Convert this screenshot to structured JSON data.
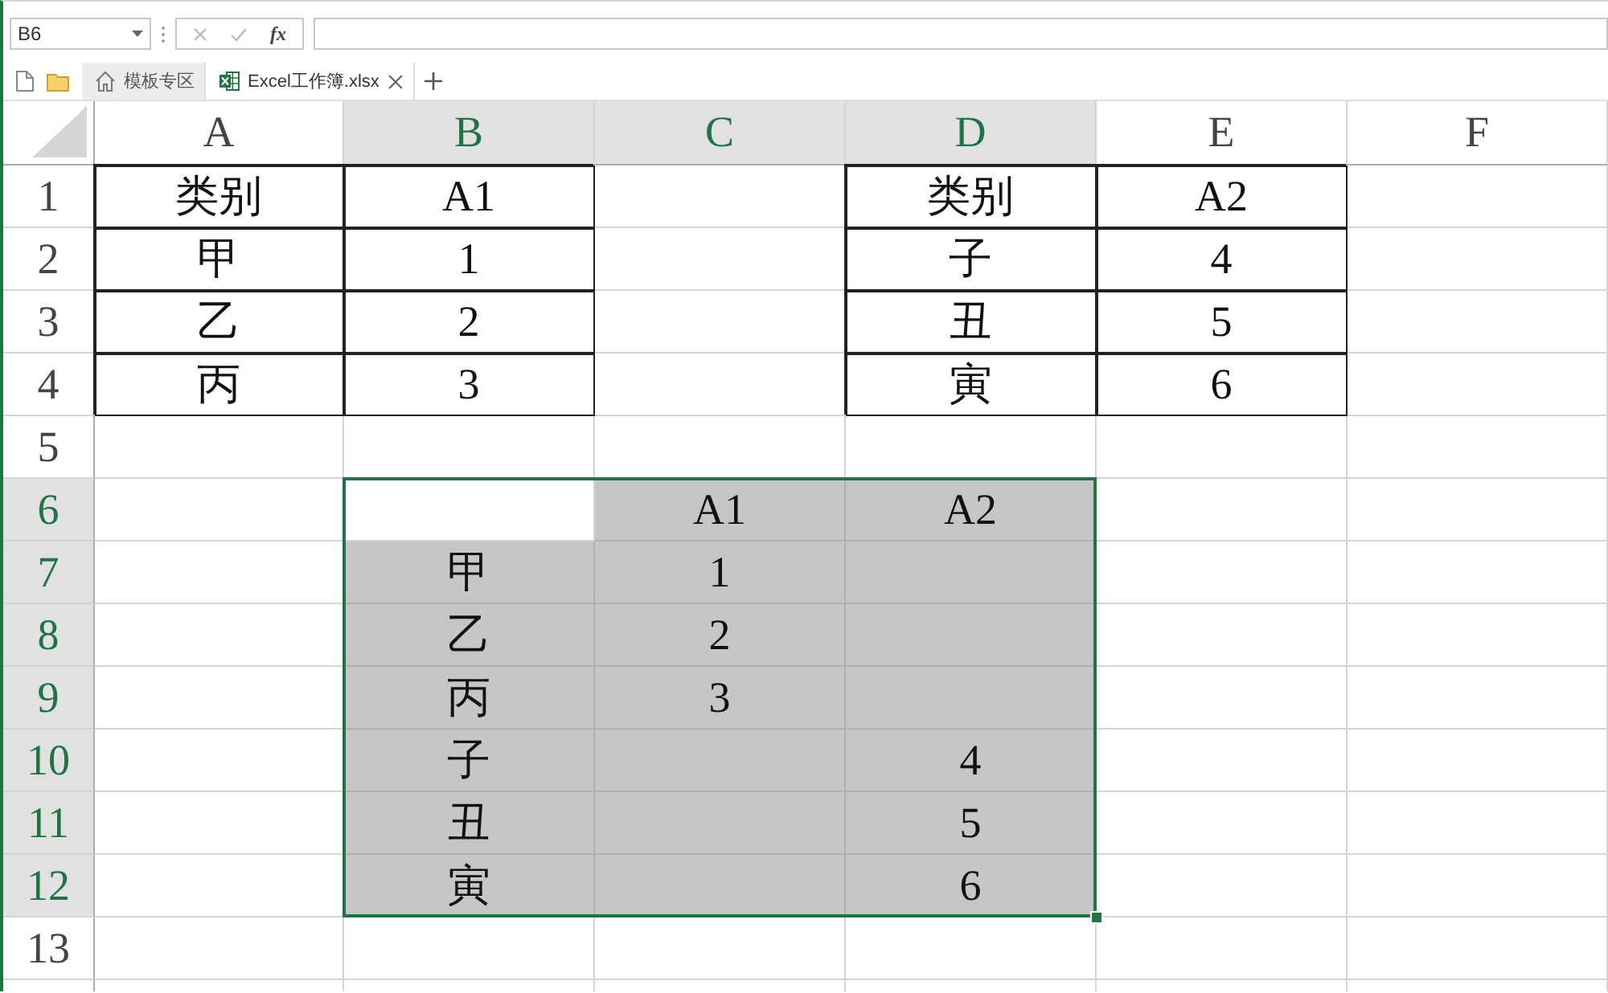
{
  "name_box": {
    "value": "B6"
  },
  "formula_bar": {
    "function_button": "fx"
  },
  "tabs": [
    {
      "label": "模板专区",
      "kind": "home",
      "selected": false,
      "closable": false
    },
    {
      "label": "Excel工作簿.xlsx",
      "kind": "workbook",
      "selected": true,
      "closable": true
    }
  ],
  "columns": [
    {
      "label": "A",
      "selected": false
    },
    {
      "label": "B",
      "selected": true
    },
    {
      "label": "C",
      "selected": true
    },
    {
      "label": "D",
      "selected": true
    },
    {
      "label": "E",
      "selected": false
    },
    {
      "label": "F",
      "selected": false
    }
  ],
  "rows": [
    {
      "label": "1",
      "selected": false,
      "cells": [
        {
          "text": "类别",
          "bordered": true,
          "shaded": false
        },
        {
          "text": "A1",
          "bordered": true,
          "shaded": false
        },
        {
          "bordered": false,
          "shaded": false
        },
        {
          "text": "类别",
          "bordered": true,
          "shaded": false
        },
        {
          "text": "A2",
          "bordered": true,
          "shaded": false
        },
        {
          "bordered": false,
          "shaded": false
        }
      ]
    },
    {
      "label": "2",
      "selected": false,
      "cells": [
        {
          "text": "甲",
          "bordered": true,
          "shaded": false
        },
        {
          "text": "1",
          "bordered": true,
          "shaded": false
        },
        {
          "bordered": false,
          "shaded": false
        },
        {
          "text": "子",
          "bordered": true,
          "shaded": false
        },
        {
          "text": "4",
          "bordered": true,
          "shaded": false
        },
        {
          "bordered": false,
          "shaded": false
        }
      ]
    },
    {
      "label": "3",
      "selected": false,
      "cells": [
        {
          "text": "乙",
          "bordered": true,
          "shaded": false
        },
        {
          "text": "2",
          "bordered": true,
          "shaded": false
        },
        {
          "bordered": false,
          "shaded": false
        },
        {
          "text": "丑",
          "bordered": true,
          "shaded": false
        },
        {
          "text": "5",
          "bordered": true,
          "shaded": false
        },
        {
          "bordered": false,
          "shaded": false
        }
      ]
    },
    {
      "label": "4",
      "selected": false,
      "cells": [
        {
          "text": "丙",
          "bordered": true,
          "shaded": false
        },
        {
          "text": "3",
          "bordered": true,
          "shaded": false
        },
        {
          "bordered": false,
          "shaded": false
        },
        {
          "text": "寅",
          "bordered": true,
          "shaded": false
        },
        {
          "text": "6",
          "bordered": true,
          "shaded": false
        },
        {
          "bordered": false,
          "shaded": false
        }
      ]
    },
    {
      "label": "5",
      "selected": false,
      "cells": [
        {
          "bordered": false,
          "shaded": false
        },
        {
          "bordered": false,
          "shaded": false
        },
        {
          "bordered": false,
          "shaded": false
        },
        {
          "bordered": false,
          "shaded": false
        },
        {
          "bordered": false,
          "shaded": false
        },
        {
          "bordered": false,
          "shaded": false
        }
      ]
    },
    {
      "label": "6",
      "selected": true,
      "cells": [
        {
          "bordered": false,
          "shaded": false
        },
        {
          "bordered": false,
          "shaded": false
        },
        {
          "text": "A1",
          "bordered": false,
          "shaded": true
        },
        {
          "text": "A2",
          "bordered": false,
          "shaded": true
        },
        {
          "bordered": false,
          "shaded": false
        },
        {
          "bordered": false,
          "shaded": false
        }
      ]
    },
    {
      "label": "7",
      "selected": true,
      "cells": [
        {
          "bordered": false,
          "shaded": false
        },
        {
          "text": "甲",
          "bordered": false,
          "shaded": true
        },
        {
          "text": "1",
          "bordered": false,
          "shaded": true
        },
        {
          "bordered": false,
          "shaded": true
        },
        {
          "bordered": false,
          "shaded": false
        },
        {
          "bordered": false,
          "shaded": false
        }
      ]
    },
    {
      "label": "8",
      "selected": true,
      "cells": [
        {
          "bordered": false,
          "shaded": false
        },
        {
          "text": "乙",
          "bordered": false,
          "shaded": true
        },
        {
          "text": "2",
          "bordered": false,
          "shaded": true
        },
        {
          "bordered": false,
          "shaded": true
        },
        {
          "bordered": false,
          "shaded": false
        },
        {
          "bordered": false,
          "shaded": false
        }
      ]
    },
    {
      "label": "9",
      "selected": true,
      "cells": [
        {
          "bordered": false,
          "shaded": false
        },
        {
          "text": "丙",
          "bordered": false,
          "shaded": true
        },
        {
          "text": "3",
          "bordered": false,
          "shaded": true
        },
        {
          "bordered": false,
          "shaded": true
        },
        {
          "bordered": false,
          "shaded": false
        },
        {
          "bordered": false,
          "shaded": false
        }
      ]
    },
    {
      "label": "10",
      "selected": true,
      "cells": [
        {
          "bordered": false,
          "shaded": false
        },
        {
          "text": "子",
          "bordered": false,
          "shaded": true
        },
        {
          "bordered": false,
          "shaded": true
        },
        {
          "text": "4",
          "bordered": false,
          "shaded": true
        },
        {
          "bordered": false,
          "shaded": false
        },
        {
          "bordered": false,
          "shaded": false
        }
      ]
    },
    {
      "label": "11",
      "selected": true,
      "cells": [
        {
          "bordered": false,
          "shaded": false
        },
        {
          "text": "丑",
          "bordered": false,
          "shaded": true
        },
        {
          "bordered": false,
          "shaded": true
        },
        {
          "text": "5",
          "bordered": false,
          "shaded": true
        },
        {
          "bordered": false,
          "shaded": false
        },
        {
          "bordered": false,
          "shaded": false
        }
      ]
    },
    {
      "label": "12",
      "selected": true,
      "cells": [
        {
          "bordered": false,
          "shaded": false
        },
        {
          "text": "寅",
          "bordered": false,
          "shaded": true
        },
        {
          "bordered": false,
          "shaded": true
        },
        {
          "text": "6",
          "bordered": false,
          "shaded": true
        },
        {
          "bordered": false,
          "shaded": false
        },
        {
          "bordered": false,
          "shaded": false
        }
      ]
    },
    {
      "label": "13",
      "selected": false,
      "cells": [
        {
          "bordered": false,
          "shaded": false
        },
        {
          "bordered": false,
          "shaded": false
        },
        {
          "bordered": false,
          "shaded": false
        },
        {
          "bordered": false,
          "shaded": false
        },
        {
          "bordered": false,
          "shaded": false
        },
        {
          "bordered": false,
          "shaded": false
        }
      ]
    }
  ]
}
